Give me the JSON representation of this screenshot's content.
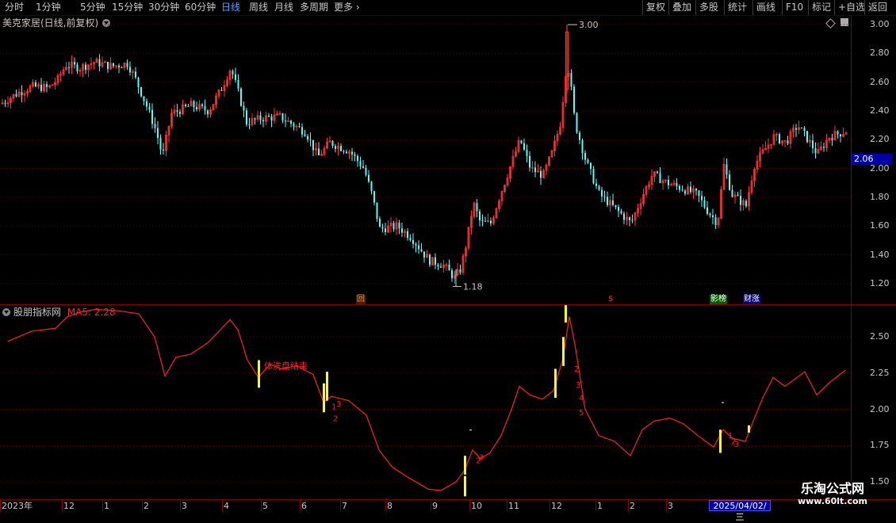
{
  "toolbar": {
    "left": [
      {
        "label": "分时",
        "active": false
      },
      {
        "label": "1分钟",
        "active": false
      },
      {
        "label": "5分钟",
        "active": false
      },
      {
        "label": "15分钟",
        "active": false
      },
      {
        "label": "30分钟",
        "active": false
      },
      {
        "label": "60分钟",
        "active": false
      },
      {
        "label": "日线",
        "active": true
      },
      {
        "label": "周线",
        "active": false
      },
      {
        "label": "月线",
        "active": false
      },
      {
        "label": "多周期",
        "active": false
      },
      {
        "label": "更多",
        "active": false
      }
    ],
    "right": [
      "复权",
      "叠加",
      "多股",
      "统计",
      "画线",
      "F10",
      "标记",
      "+自选",
      "返回"
    ]
  },
  "main_pane": {
    "title": "美克家居(日线,前复权)",
    "price_ticks": [
      "3.00",
      "2.80",
      "2.60",
      "2.40",
      "2.20",
      "2.00",
      "1.80",
      "1.60",
      "1.40",
      "1.20"
    ],
    "current_price": "2.06",
    "high_label": "3.00",
    "low_label": "1.18",
    "event_markers": [
      {
        "text": "回",
        "color": "#ff8c00",
        "bg": "#402000"
      },
      {
        "text": "$",
        "color": "#ff3030",
        "bg": ""
      },
      {
        "text": "影榜",
        "color": "#ffffff",
        "bg": "#006000"
      },
      {
        "text": "财涨",
        "color": "#ffffff",
        "bg": "#000080"
      }
    ]
  },
  "indicator_pane": {
    "title": "股朋指标网",
    "ma_label": "MA5: 2.28",
    "ticks": [
      "2.50",
      "2.25",
      "2.00",
      "1.75",
      "1.50"
    ],
    "annotation": "体洗盘结束",
    "signal_numbers": [
      "1",
      "2",
      "3",
      "4",
      "5"
    ]
  },
  "x_axis": {
    "labels": [
      "2023年",
      "12",
      "1",
      "2",
      "3",
      "4",
      "5",
      "6",
      "7",
      "8",
      "9",
      "10",
      "11",
      "12",
      "1",
      "2",
      "3"
    ],
    "cursor_date": "2025/04/02/三"
  },
  "watermark": {
    "line1": "乐淘公式网",
    "line2": "www.60lt.com"
  },
  "colors": {
    "up": "#ff3232",
    "down": "#54fcfc",
    "ma_line": "#ff2020",
    "grid": "#5a0000",
    "signal": "#ffff00",
    "cursor_bg": "#0000a8"
  },
  "chart_data": {
    "type": "candlestick",
    "ylim": [
      1.1,
      3.05
    ],
    "high": 3.0,
    "low": 1.18,
    "indicator_ylim": [
      1.38,
      2.72
    ],
    "ma5_last": 2.28
  }
}
